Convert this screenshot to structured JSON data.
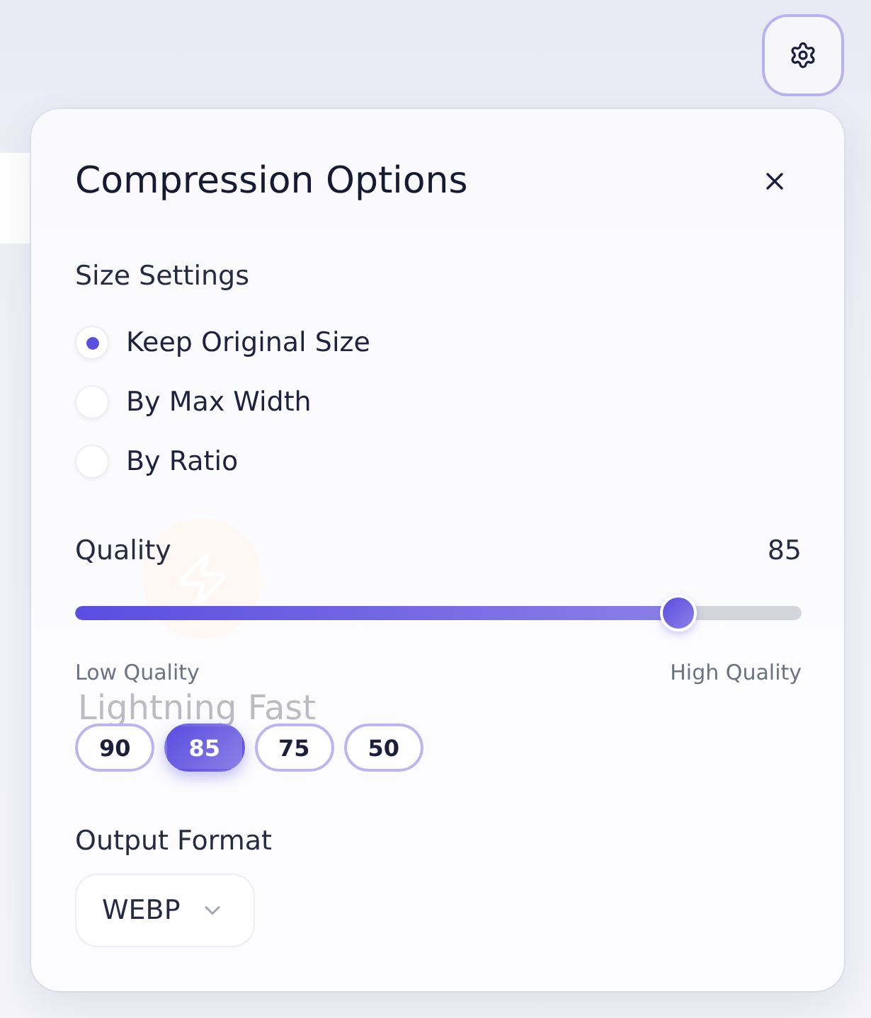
{
  "settings_button": {
    "active": true
  },
  "background": {
    "feature_title": "Lightning Fast"
  },
  "panel": {
    "title": "Compression Options",
    "size_settings": {
      "label": "Size Settings",
      "options": [
        {
          "label": "Keep Original Size",
          "selected": true
        },
        {
          "label": "By Max Width",
          "selected": false
        },
        {
          "label": "By Ratio",
          "selected": false
        }
      ]
    },
    "quality": {
      "label": "Quality",
      "reading": "85",
      "level": 0.83,
      "min_label": "Low Quality",
      "max_label": "High Quality",
      "presets": [
        {
          "label": "90",
          "selected": false
        },
        {
          "label": "85",
          "selected": true
        },
        {
          "label": "75",
          "selected": false
        },
        {
          "label": "50",
          "selected": false
        }
      ]
    },
    "output_format": {
      "label": "Output Format",
      "value": "WEBP"
    }
  }
}
